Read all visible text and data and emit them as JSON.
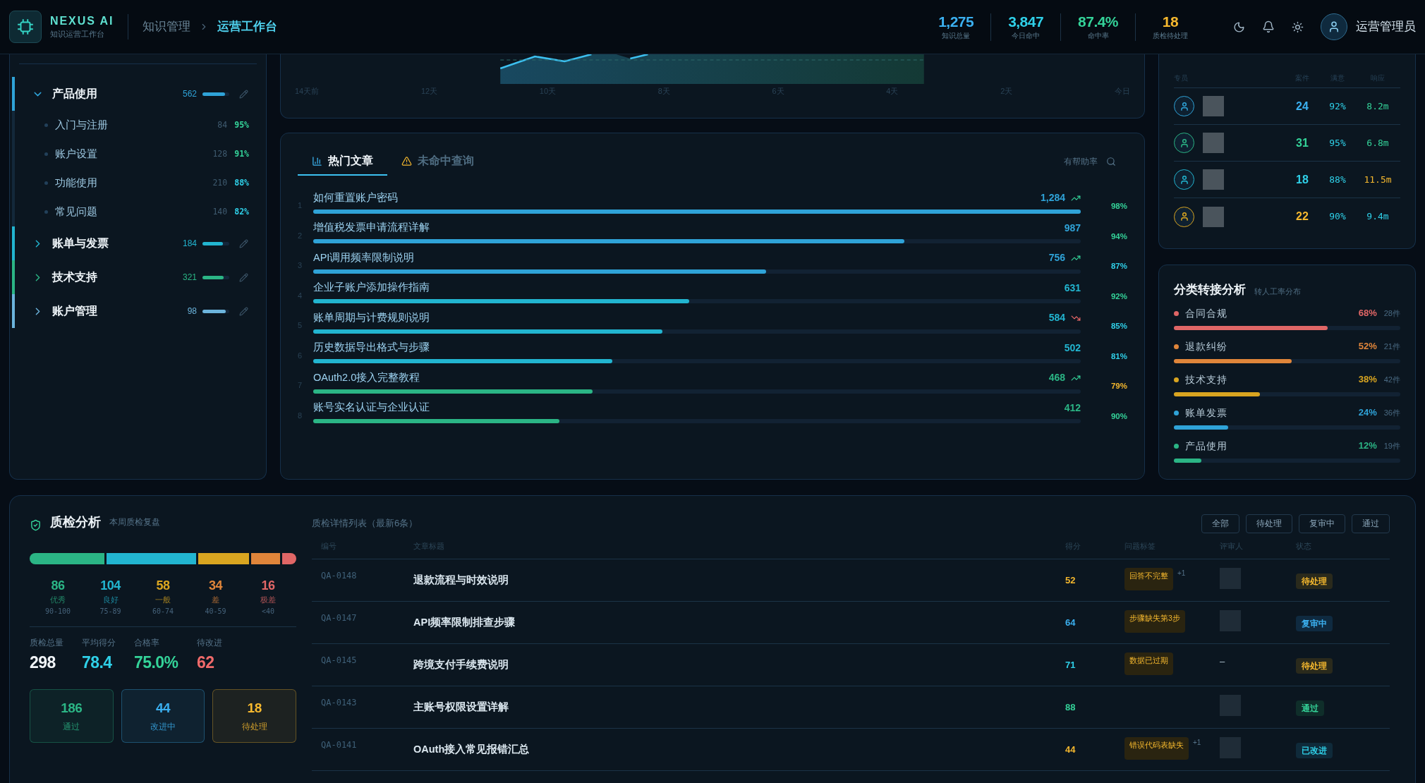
{
  "header": {
    "brand": "NEXUS AI",
    "subtitle": "知识运营工作台",
    "breadcrumb": [
      {
        "label": "知识管理",
        "selected": false
      },
      {
        "label": "运营工作台",
        "selected": true
      }
    ],
    "stats": [
      {
        "value": "1,275",
        "label": "知识总量",
        "color": "#3bb0f0"
      },
      {
        "value": "3,847",
        "label": "今日命中",
        "color": "#2fd0e8"
      },
      {
        "value": "87.4%",
        "label": "命中率",
        "color": "#34d399"
      },
      {
        "value": "18",
        "label": "质检待处理",
        "color": "#f5b82e"
      }
    ],
    "user": "运营管理员"
  },
  "sidebar": {
    "categories": [
      {
        "name": "产品使用",
        "count": "562",
        "level": 0.85,
        "color": "#2fa3d8",
        "expanded": true,
        "children": [
          {
            "name": "入门与注册",
            "count": "84",
            "rate": "95%",
            "color": "#34d399"
          },
          {
            "name": "账户设置",
            "count": "128",
            "rate": "91%",
            "color": "#34d399"
          },
          {
            "name": "功能使用",
            "count": "210",
            "rate": "88%",
            "color": "#2fd0e8"
          },
          {
            "name": "常见问题",
            "count": "140",
            "rate": "82%",
            "color": "#2fd0e8"
          }
        ]
      },
      {
        "name": "账单与发票",
        "count": "184",
        "level": 0.75,
        "color": "#22b5d0",
        "expanded": false
      },
      {
        "name": "技术支持",
        "count": "321",
        "level": 0.8,
        "color": "#2bb585",
        "expanded": false
      },
      {
        "name": "账户管理",
        "count": "98",
        "level": 0.88,
        "color": "#6cb4dc",
        "expanded": false
      }
    ]
  },
  "trend_chart": {
    "x_labels": [
      "14天前",
      "12天",
      "10天",
      "8天",
      "6天",
      "4天",
      "2天",
      "今日"
    ]
  },
  "articles": {
    "tabs": [
      {
        "label": "热门文章",
        "kind": "chart",
        "selected": true
      },
      {
        "label": "未命中查询",
        "kind": "warning",
        "selected": false
      }
    ],
    "helpful_label": "有帮助率",
    "rows": [
      {
        "rank": "1",
        "title": "如何重置账户密码",
        "count": "1,284",
        "kind": "up",
        "level": 1.0,
        "color": "#2fa3d8",
        "helpful": {
          "text": "98%",
          "color": "#34d399"
        }
      },
      {
        "rank": "2",
        "title": "增值税发票申请流程详解",
        "count": "987",
        "kind": "flat",
        "level": 0.77,
        "color": "#2fa3d8",
        "helpful": {
          "text": "94%",
          "color": "#34d399"
        }
      },
      {
        "rank": "3",
        "title": "API调用频率限制说明",
        "count": "756",
        "kind": "up",
        "level": 0.59,
        "color": "#2fa3d8",
        "helpful": {
          "text": "87%",
          "color": "#2fd0e8"
        }
      },
      {
        "rank": "4",
        "title": "企业子账户添加操作指南",
        "count": "631",
        "kind": "flat",
        "level": 0.49,
        "color": "#22b5d0",
        "helpful": {
          "text": "92%",
          "color": "#34d399"
        }
      },
      {
        "rank": "5",
        "title": "账单周期与计费规则说明",
        "count": "584",
        "kind": "down",
        "level": 0.455,
        "color": "#22b5d0",
        "helpful": {
          "text": "85%",
          "color": "#2fd0e8"
        }
      },
      {
        "rank": "6",
        "title": "历史数据导出格式与步骤",
        "count": "502",
        "kind": "flat",
        "level": 0.39,
        "color": "#22b5d0",
        "helpful": {
          "text": "81%",
          "color": "#2fd0e8"
        }
      },
      {
        "rank": "7",
        "title": "OAuth2.0接入完整教程",
        "count": "468",
        "kind": "up",
        "level": 0.364,
        "color": "#2bb585",
        "helpful": {
          "text": "79%",
          "color": "#f5b82e"
        }
      },
      {
        "rank": "8",
        "title": "账号实名认证与企业认证",
        "count": "412",
        "kind": "flat",
        "level": 0.321,
        "color": "#2bb585",
        "helpful": {
          "text": "90%",
          "color": "#34d399"
        }
      }
    ]
  },
  "agents": {
    "columns": [
      "专员",
      "案件",
      "满意",
      "响应"
    ],
    "rows": [
      {
        "color": "#2fa3d8",
        "cases": {
          "text": "24",
          "color": "#3bb0f0"
        },
        "satisfaction": "92%",
        "response": {
          "text": "8.2m",
          "color": "#34d399"
        }
      },
      {
        "color": "#2bb585",
        "cases": {
          "text": "31",
          "color": "#34d399"
        },
        "satisfaction": "95%",
        "response": {
          "text": "6.8m",
          "color": "#34d399"
        }
      },
      {
        "color": "#22b5d0",
        "cases": {
          "text": "18",
          "color": "#2fd0e8"
        },
        "satisfaction": "88%",
        "response": {
          "text": "11.5m",
          "color": "#f5b82e"
        }
      },
      {
        "color": "#d9a520",
        "cases": {
          "text": "22",
          "color": "#f5b82e"
        },
        "satisfaction": "90%",
        "response": {
          "text": "9.4m",
          "color": "#2fd0e8"
        }
      }
    ]
  },
  "transfer": {
    "title": "分类转接分析",
    "subtitle": "转人工率分布",
    "items": [
      {
        "name": "合同合规",
        "pct": "68%",
        "count": "28件",
        "level": 0.68,
        "color": "#e06666"
      },
      {
        "name": "退款纠纷",
        "pct": "52%",
        "count": "21件",
        "level": 0.52,
        "color": "#e0853a"
      },
      {
        "name": "技术支持",
        "pct": "38%",
        "count": "42件",
        "level": 0.38,
        "color": "#d9a520"
      },
      {
        "name": "账单发票",
        "pct": "24%",
        "count": "36件",
        "level": 0.24,
        "color": "#2fa3d8"
      },
      {
        "name": "产品使用",
        "pct": "12%",
        "count": "19件",
        "level": 0.12,
        "color": "#2bb585"
      }
    ]
  },
  "quality": {
    "title": "质检分析",
    "subtitle": "本周质检复盘",
    "grades": [
      {
        "count": "86",
        "label": "优秀",
        "range": "90-100",
        "color": "#2bb585"
      },
      {
        "count": "104",
        "label": "良好",
        "range": "75-89",
        "color": "#22b5d0"
      },
      {
        "count": "58",
        "label": "一般",
        "range": "60-74",
        "color": "#d9a520"
      },
      {
        "count": "34",
        "label": "差",
        "range": "40-59",
        "color": "#e0853a"
      },
      {
        "count": "16",
        "label": "极差",
        "range": "<40",
        "color": "#e06666"
      }
    ],
    "summary": [
      {
        "label": "质检总量",
        "value": "298",
        "color": "#f1f5f9"
      },
      {
        "label": "平均得分",
        "value": "78.4",
        "color": "#2fd0e8"
      },
      {
        "label": "合格率",
        "value": "75.0%",
        "color": "#34d399"
      },
      {
        "label": "待改进",
        "value": "62",
        "color": "#f06a6a"
      }
    ],
    "boxes": [
      {
        "value": "186",
        "label": "通过",
        "color": "#2bb585"
      },
      {
        "value": "44",
        "label": "改进中",
        "color": "#3bb0f0"
      },
      {
        "value": "18",
        "label": "待处理",
        "color": "#f5b82e"
      }
    ]
  },
  "qa_table": {
    "title": "质检详情列表（最新6条）",
    "filters": [
      {
        "label": "全部",
        "selected": false
      },
      {
        "label": "待处理",
        "selected": false
      },
      {
        "label": "复审中",
        "selected": false
      },
      {
        "label": "通过",
        "selected": false
      }
    ],
    "columns": [
      "编号",
      "文章标题",
      "得分",
      "问题标签",
      "评审人",
      "状态"
    ],
    "rows": [
      {
        "id": "QA-0148",
        "title": "退款流程与时效说明",
        "score": {
          "text": "52",
          "color": "#f5b82e"
        },
        "tag": "回答不完整",
        "extra": "+1",
        "redacted": true,
        "status": "待处理",
        "kind": "pending"
      },
      {
        "id": "QA-0147",
        "title": "API频率限制排查步骤",
        "score": {
          "text": "64",
          "color": "#3bb0f0"
        },
        "tag": "步骤缺失第3步",
        "redacted": true,
        "status": "复审中",
        "kind": "review"
      },
      {
        "id": "QA-0145",
        "title": "跨境支付手续费说明",
        "score": {
          "text": "71",
          "color": "#2fd0e8"
        },
        "tag": "数据已过期",
        "reviewer": "–",
        "redacted": false,
        "status": "待处理",
        "kind": "pending"
      },
      {
        "id": "QA-0143",
        "title": "主账号权限设置详解",
        "score": {
          "text": "88",
          "color": "#34d399"
        },
        "redacted": true,
        "status": "通过",
        "kind": "pass"
      },
      {
        "id": "QA-0141",
        "title": "OAuth接入常见报错汇总",
        "score": {
          "text": "44",
          "color": "#f5b82e"
        },
        "tag": "错误代码表缺失",
        "extra": "+1",
        "redacted": true,
        "status": "已改进",
        "kind": "improved"
      }
    ]
  }
}
